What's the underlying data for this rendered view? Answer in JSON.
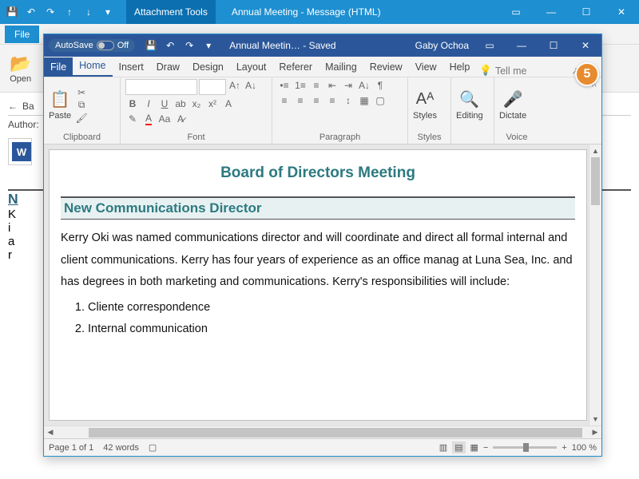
{
  "outlook": {
    "tools_tab": "Attachment Tools",
    "title": "Annual Meeting  -  Message (HTML)",
    "file_tab": "File",
    "open_label": "Open",
    "back_label": "Ba",
    "author_label": "Author:",
    "partial_heading": "N",
    "partial_lines": [
      "K",
      "i",
      "a",
      "r"
    ]
  },
  "word": {
    "autosave": "AutoSave",
    "autosave_state": "Off",
    "title": "Annual Meetin…  -  Saved",
    "user": "Gaby Ochoa",
    "tabs": {
      "file": "File",
      "home": "Home",
      "insert": "Insert",
      "draw": "Draw",
      "design": "Design",
      "layout": "Layout",
      "referer": "Referer",
      "mailing": "Mailing",
      "review": "Review",
      "view": "View",
      "help": "Help"
    },
    "tellme": "Tell me",
    "groups": {
      "clipboard": "Clipboard",
      "paste": "Paste",
      "font": "Font",
      "paragraph": "Paragraph",
      "styles": "Styles",
      "styles_btn": "Styles",
      "editing": "Editing",
      "voice": "Voice",
      "dictate": "Dictate"
    },
    "doc": {
      "title": "Board of Directors Meeting",
      "section": "New Communications Director",
      "body": "Kerry Oki was named communications director and will coordinate and direct all formal internal and client communications. Kerry has four years of experience as an office manag at Luna Sea, Inc. and has degrees in both marketing and communications. Kerry's responsibilities will include:",
      "li1": "Cliente correspondence",
      "li2": "Internal communication"
    },
    "status": {
      "page": "Page 1 of 1",
      "words": "42 words",
      "zoom": "100 %"
    }
  },
  "callout": "5",
  "chart_data": {
    "type": "table",
    "title": "none",
    "note": "not a chart"
  }
}
